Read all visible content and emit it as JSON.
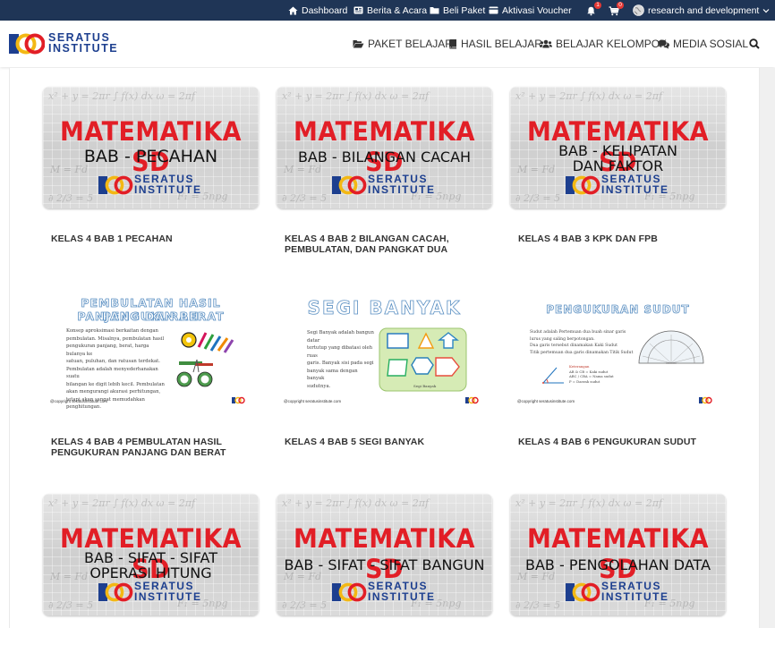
{
  "topbar": {
    "dashboard": "Dashboard",
    "news": "Berita & Acara",
    "buy": "Beli Paket",
    "voucher": "Aktivasi Voucher",
    "notif_count": "1",
    "cart_count": "0",
    "user": "research and development"
  },
  "header": {
    "logo_line1": "SERATUS",
    "logo_line2": "INSTITUTE",
    "nav": {
      "paket": "PAKET BELAJAR",
      "hasil": "HASIL BELAJAR",
      "kelompok": "BELAJAR KELOMPOK",
      "media": "MEDIA SOSIAL"
    }
  },
  "colors": {
    "topbar": "#1f3556",
    "brand_blue": "#1d3f8f",
    "brand_red": "#e21e26",
    "brand_yellow": "#f3b814"
  },
  "icons": [
    "home-icon",
    "newspaper-icon",
    "folder-icon",
    "credit-card-icon",
    "bell-icon",
    "cart-icon",
    "globe-icon",
    "chevron-down-icon",
    "folder-open-icon",
    "book-icon",
    "users-icon",
    "comments-icon",
    "search-icon"
  ],
  "cards": [
    {
      "title": "KELAS 4 BAB 1 PECAHAN",
      "main": "MATEMATIKA SD",
      "sub1": "BAB - PECAHAN",
      "sub2": ""
    },
    {
      "title": "KELAS 4 BAB 2 BILANGAN CACAH, PEMBULATAN, DAN PANGKAT DUA",
      "main": "MATEMATIKA SD",
      "sub1": "BAB - BILANGAN CACAH",
      "sub2": ""
    },
    {
      "title": "KELAS 4 BAB 3 KPK DAN FPB",
      "main": "MATEMATIKA SD",
      "sub1": "BAB - KELIPATAN",
      "sub2": "DAN FAKTOR"
    },
    {
      "title": "KELAS 4 BAB 4 PEMBULATAN HASIL PENGUKURAN PANJANG DAN BERAT",
      "slide_title1": "PEMBULATAN HASIL PENGUKURAN",
      "slide_title2": "PANJANG DAN BERAT",
      "text": [
        "Konsep aproksimasi berkaitan dengan",
        "pembulatan. Misalnya, pembulatan hasil",
        "pengukuran panjang, berat, harga bulanya ke",
        "satuan, puluhan, dan ratusan terdekat.",
        "Pembulatan adalah menyederhanakan suatu",
        "bilangan ke digit lebih kecil. Pembulatan",
        "akan mengurangi akurasi perhitungan,",
        "tetapi akan sangat memudahkan",
        "penghitungan."
      ]
    },
    {
      "title": "KELAS 4 BAB 5 SEGI BANYAK",
      "slide_title1": "SEGI BANYAK",
      "text": [
        "Segi Banyak adalah bangun datar",
        "tertutup yang dibatasi oleh ruas",
        "garis. Banyak sisi pada segi",
        "banyak sama dengan banyak",
        "sudutnya."
      ],
      "caption": "Segi Banyak"
    },
    {
      "title": "KELAS 4 BAB 6 PENGUKURAN SUDUT",
      "slide_title1": "PENGUKURAN SUDUT",
      "text": [
        "Sudut adalah Pertemuan dua buah sinar garis",
        "lurus yang saling berpotongan.",
        "Dua garis tersebut dinamakan Kaki Sudut",
        "Titik pertemuan dua garis dinamakan Titik Sudut"
      ],
      "legend": [
        "Keterangan",
        "AB & CB  = Kaki sudut",
        "ABC / CBA  = Nama sudut",
        "P  = Daerah sudut"
      ]
    },
    {
      "title": "",
      "main": "MATEMATIKA SD",
      "sub1": "BAB - SIFAT - SIFAT",
      "sub2": "OPERASI HITUNG"
    },
    {
      "title": "",
      "main": "MATEMATIKA SD",
      "sub1": "BAB - SIFAT - SIFAT BANGUN",
      "sub2": ""
    },
    {
      "title": "",
      "main": "MATEMATIKA SD",
      "sub1": "BAB - PENGOLAHAN DATA",
      "sub2": ""
    }
  ],
  "slide_copyright": "@copyright seratusinstitute.com"
}
